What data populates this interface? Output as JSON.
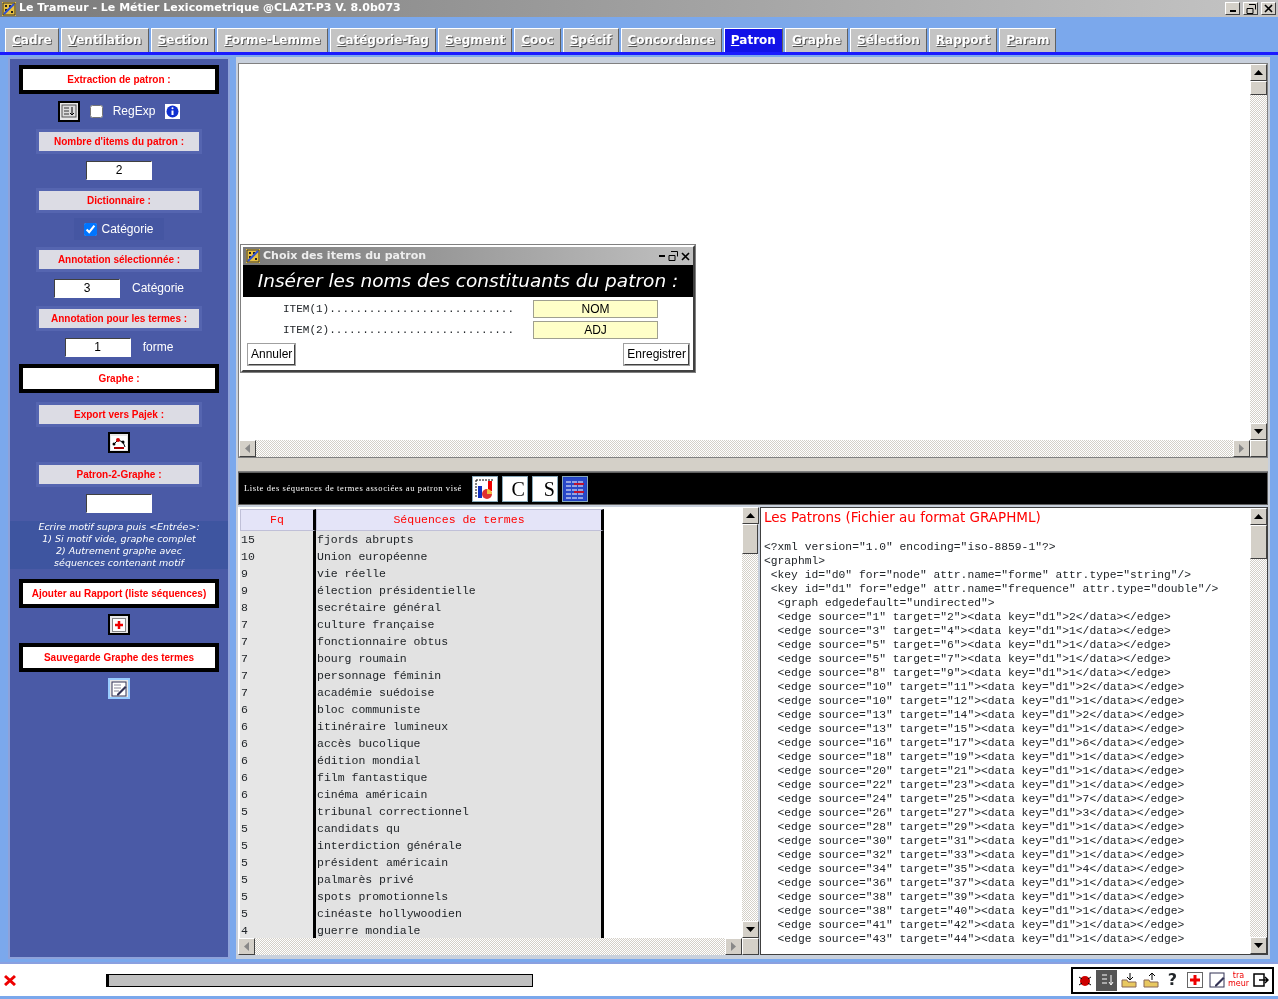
{
  "window": {
    "title": "Le Trameur - Le Métier Lexicometrique @CLA2T-P3 V. 8.0b073"
  },
  "tabs": [
    {
      "label": "Cadre",
      "selected": false
    },
    {
      "label": "Ventilation",
      "selected": false
    },
    {
      "label": "Section",
      "selected": false
    },
    {
      "label": "Forme-Lemme",
      "selected": false
    },
    {
      "label": "Catégorie-Tag",
      "selected": false
    },
    {
      "label": "Segment",
      "selected": false
    },
    {
      "label": "Cooc",
      "selected": false
    },
    {
      "label": "Spécif",
      "selected": false
    },
    {
      "label": "Concordance",
      "selected": false
    },
    {
      "label": "Patron",
      "selected": true
    },
    {
      "label": "Graphe",
      "selected": false
    },
    {
      "label": "Sélection",
      "selected": false
    },
    {
      "label": "Rapport",
      "selected": false
    },
    {
      "label": "Param",
      "selected": false
    }
  ],
  "left_panel": [
    {
      "kind": "boxed",
      "text": "Extraction de patron :"
    },
    {
      "kind": "regexp",
      "label": "RegExp",
      "checked": false
    },
    {
      "kind": "label",
      "text": "Nombre d'items du patron :"
    },
    {
      "kind": "field",
      "value": "2"
    },
    {
      "kind": "label",
      "text": "Dictionnaire :"
    },
    {
      "kind": "check",
      "label": "Catégorie",
      "checked": true
    },
    {
      "kind": "label",
      "text": "Annotation sélectionnée :"
    },
    {
      "kind": "field",
      "value": "3",
      "caption": "Catégorie"
    },
    {
      "kind": "label",
      "text": "Annotation pour les termes :"
    },
    {
      "kind": "field",
      "value": "1",
      "caption": "forme"
    },
    {
      "kind": "boxed",
      "text": "Graphe :"
    },
    {
      "kind": "label",
      "text": "Export vers Pajek :"
    },
    {
      "kind": "pajek"
    },
    {
      "kind": "label",
      "text": "Patron-2-Graphe :"
    },
    {
      "kind": "field"
    },
    {
      "kind": "note",
      "lines": [
        "Ecrire motif supra puis <Entrée>:",
        "1) Si motif vide, graphe complet",
        "2)  Autrement graphe avec",
        "séquences contenant motif"
      ]
    },
    {
      "kind": "boxed",
      "text": "Ajouter au Rapport (liste séquences)"
    },
    {
      "kind": "add"
    },
    {
      "kind": "boxed",
      "text": "Sauvegarde Graphe des termes"
    },
    {
      "kind": "save"
    }
  ],
  "dialog": {
    "title": "Choix des items du patron",
    "banner": "Insérer les noms des constituants du patron :",
    "items": [
      {
        "label": "ITEM(1)............................",
        "value": "NOM"
      },
      {
        "label": "ITEM(2)............................",
        "value": "ADJ"
      }
    ],
    "buttons": [
      "Annuler",
      "Enregistrer"
    ]
  },
  "sequences": {
    "title": "Liste des séquences de termes associées au patron visé",
    "tools": [
      {
        "kind": "chart"
      },
      {
        "kind": "grid",
        "letter": "C"
      },
      {
        "kind": "grid",
        "letter": "S"
      },
      {
        "kind": "list"
      }
    ],
    "columns": [
      "Fq",
      "Séquences de termes"
    ],
    "rows": [
      [
        "15",
        "fjords abrupts"
      ],
      [
        "10",
        "Union européenne"
      ],
      [
        "9",
        "vie réelle"
      ],
      [
        "9",
        "élection présidentielle"
      ],
      [
        "8",
        "secrétaire général"
      ],
      [
        "7",
        "culture française"
      ],
      [
        "7",
        "fonctionnaire obtus"
      ],
      [
        "7",
        "bourg roumain"
      ],
      [
        "7",
        "personnage féminin"
      ],
      [
        "7",
        "académie suédoise"
      ],
      [
        "6",
        "bloc communiste"
      ],
      [
        "6",
        "itinéraire lumineux"
      ],
      [
        "6",
        "accès bucolique"
      ],
      [
        "6",
        "édition mondial"
      ],
      [
        "6",
        "film fantastique"
      ],
      [
        "6",
        "cinéma américain"
      ],
      [
        "5",
        "tribunal correctionnel"
      ],
      [
        "5",
        "candidats qu"
      ],
      [
        "5",
        "interdiction générale"
      ],
      [
        "5",
        "président américain"
      ],
      [
        "5",
        "palmarès privé"
      ],
      [
        "5",
        "spots promotionnels"
      ],
      [
        "5",
        "cinéaste hollywoodien"
      ],
      [
        "4",
        "guerre mondiale"
      ]
    ]
  },
  "graphml": {
    "title": "Les Patrons (Fichier au format GRAPHML)",
    "lines": [
      "<?xml version=\"1.0\" encoding=\"iso-8859-1\"?>",
      "<graphml>",
      " <key id=\"d0\" for=\"node\" attr.name=\"forme\" attr.type=\"string\"/>",
      " <key id=\"d1\" for=\"edge\" attr.name=\"frequence\" attr.type=\"double\"/>",
      "  <graph edgedefault=\"undirected\">",
      "  <edge source=\"1\" target=\"2\"><data key=\"d1\">2</data></edge>",
      "  <edge source=\"3\" target=\"4\"><data key=\"d1\">1</data></edge>",
      "  <edge source=\"5\" target=\"6\"><data key=\"d1\">1</data></edge>",
      "  <edge source=\"5\" target=\"7\"><data key=\"d1\">1</data></edge>",
      "  <edge source=\"8\" target=\"9\"><data key=\"d1\">1</data></edge>",
      "  <edge source=\"10\" target=\"11\"><data key=\"d1\">2</data></edge>",
      "  <edge source=\"10\" target=\"12\"><data key=\"d1\">1</data></edge>",
      "  <edge source=\"13\" target=\"14\"><data key=\"d1\">2</data></edge>",
      "  <edge source=\"13\" target=\"15\"><data key=\"d1\">1</data></edge>",
      "  <edge source=\"16\" target=\"17\"><data key=\"d1\">6</data></edge>",
      "  <edge source=\"18\" target=\"19\"><data key=\"d1\">1</data></edge>",
      "  <edge source=\"20\" target=\"21\"><data key=\"d1\">1</data></edge>",
      "  <edge source=\"22\" target=\"23\"><data key=\"d1\">1</data></edge>",
      "  <edge source=\"24\" target=\"25\"><data key=\"d1\">7</data></edge>",
      "  <edge source=\"26\" target=\"27\"><data key=\"d1\">3</data></edge>",
      "  <edge source=\"28\" target=\"29\"><data key=\"d1\">1</data></edge>",
      "  <edge source=\"30\" target=\"31\"><data key=\"d1\">1</data></edge>",
      "  <edge source=\"32\" target=\"33\"><data key=\"d1\">1</data></edge>",
      "  <edge source=\"34\" target=\"35\"><data key=\"d1\">4</data></edge>",
      "  <edge source=\"36\" target=\"37\"><data key=\"d1\">1</data></edge>",
      "  <edge source=\"38\" target=\"39\"><data key=\"d1\">1</data></edge>",
      "  <edge source=\"38\" target=\"40\"><data key=\"d1\">1</data></edge>",
      "  <edge source=\"41\" target=\"42\"><data key=\"d1\">1</data></edge>",
      "  <edge source=\"43\" target=\"44\"><data key=\"d1\">1</data></edge>"
    ]
  },
  "progress": {
    "level": 0
  },
  "status_bar": {
    "tools": [
      {
        "kind": "bug"
      },
      {
        "kind": "sort"
      },
      {
        "kind": "import"
      },
      {
        "kind": "export"
      },
      {
        "kind": "help",
        "text": "?"
      },
      {
        "kind": "add"
      },
      {
        "kind": "edit"
      },
      {
        "kind": "logo",
        "lines": [
          "tra",
          "meur"
        ]
      },
      {
        "kind": "exit"
      }
    ]
  }
}
